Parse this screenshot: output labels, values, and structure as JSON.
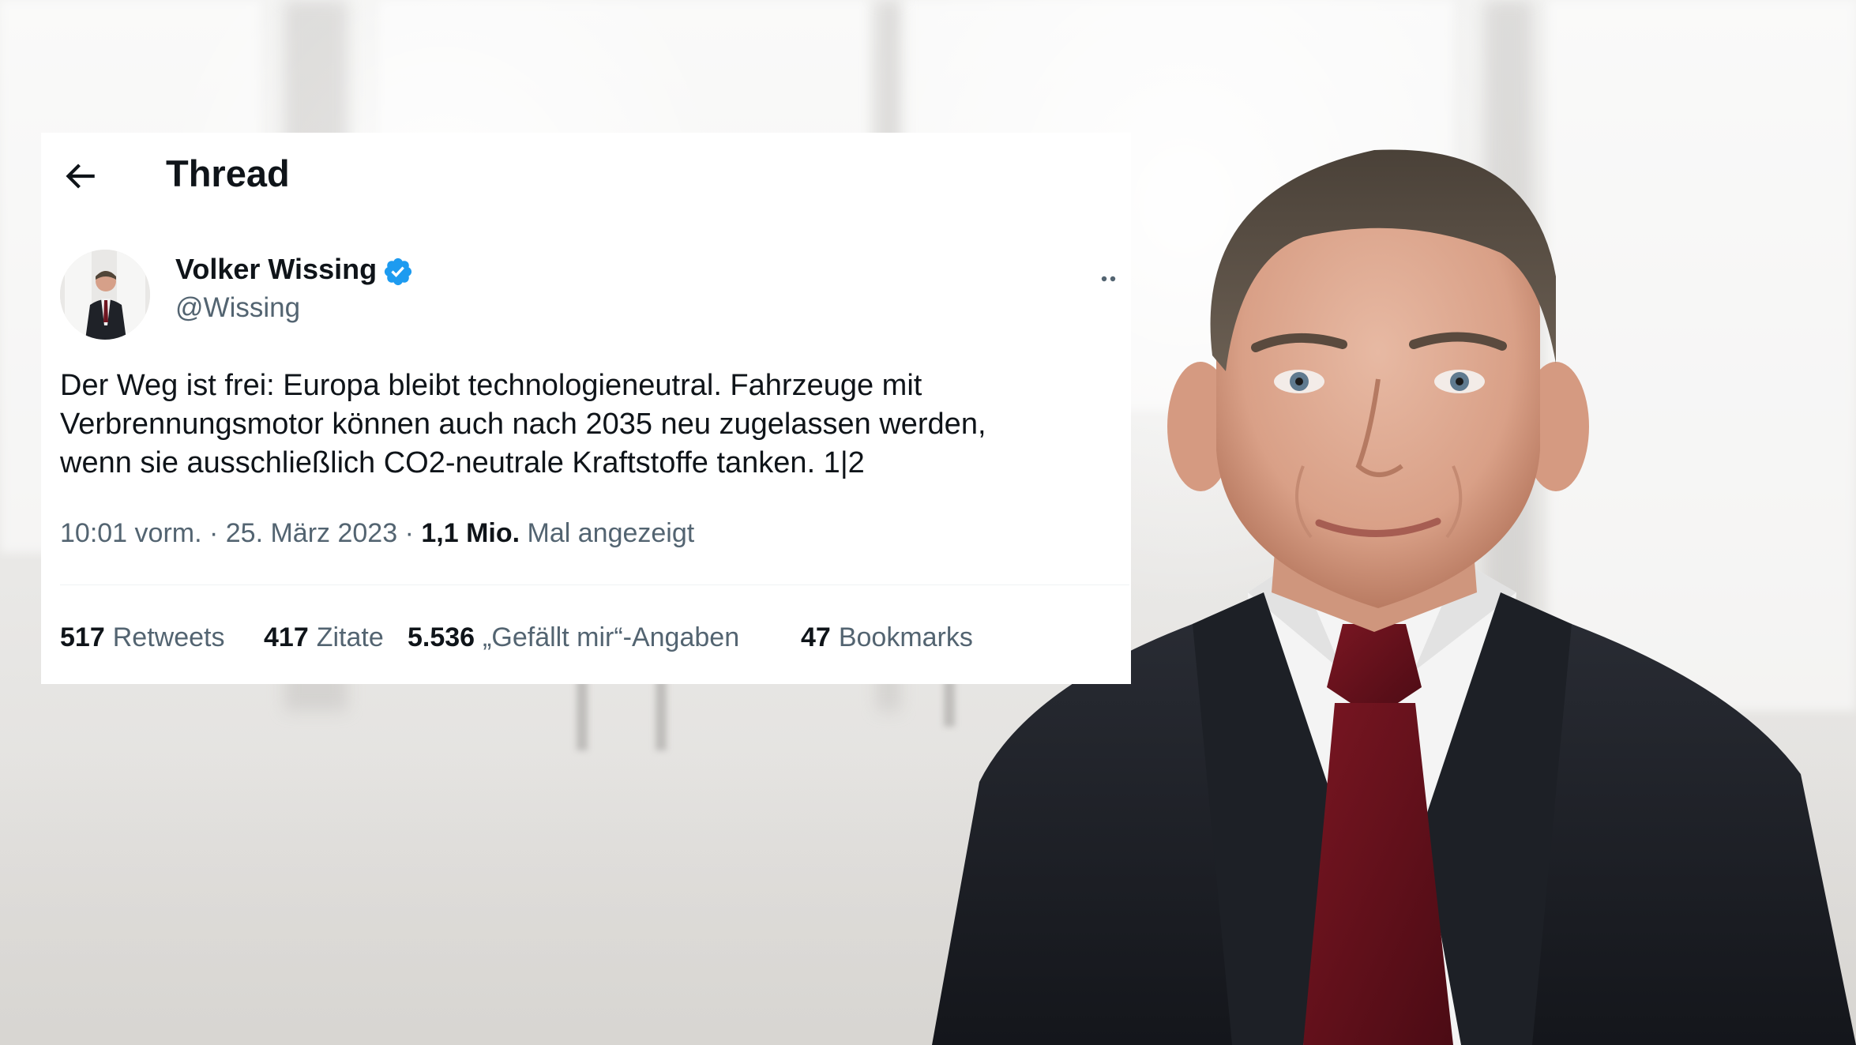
{
  "header": {
    "title": "Thread",
    "back_icon": "arrow-left-icon"
  },
  "tweet": {
    "author_name": "Volker Wissing",
    "author_handle": "@Wissing",
    "verified_color": "#1d9bf0",
    "text": "Der Weg ist frei: Europa bleibt technologieneutral. Fahrzeuge mit\nVerbrennungsmotor können auch nach 2035 neu zugelassen werden,\nwenn sie ausschließlich CO2-neutrale Kraftstoffe tanken. 1|2",
    "time": "10:01 vorm.",
    "separator": "·",
    "date": "25. März 2023",
    "views_count": "1,1 Mio.",
    "views_label": "Mal angezeigt"
  },
  "stats": {
    "retweets_count": "517",
    "retweets_label": "Retweets",
    "quotes_count": "417",
    "quotes_label": "Zitate",
    "likes_count": "5.536",
    "likes_label": "„Gefällt mir“-Angaben",
    "bookmarks_count": "47",
    "bookmarks_label": "Bookmarks"
  },
  "colors": {
    "text_primary": "#0f1419",
    "text_secondary": "#536471",
    "divider": "#eff3f4",
    "card_background": "#ffffff"
  }
}
